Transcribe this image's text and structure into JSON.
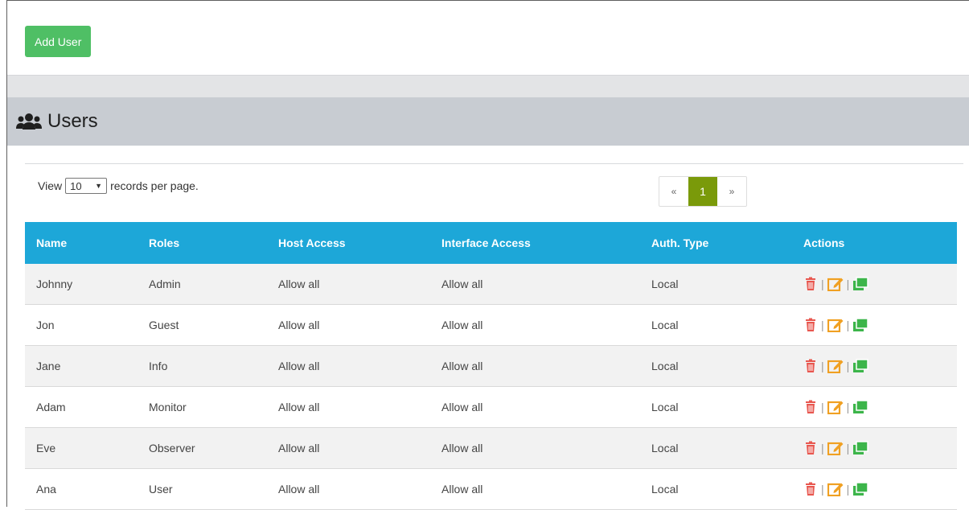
{
  "toolbar": {
    "add_user_label": "Add User"
  },
  "section": {
    "title": "Users"
  },
  "paging": {
    "view_prefix": "View",
    "records_value": "10",
    "view_suffix": "records per page.",
    "prev": "«",
    "current": "1",
    "next": "»"
  },
  "table": {
    "headers": [
      "Name",
      "Roles",
      "Host Access",
      "Interface Access",
      "Auth. Type",
      "Actions"
    ],
    "rows": [
      {
        "name": "Johnny",
        "role": "Admin",
        "host": "Allow all",
        "iface": "Allow all",
        "auth": "Local"
      },
      {
        "name": "Jon",
        "role": "Guest",
        "host": "Allow all",
        "iface": "Allow all",
        "auth": "Local"
      },
      {
        "name": "Jane",
        "role": "Info",
        "host": "Allow all",
        "iface": "Allow all",
        "auth": "Local"
      },
      {
        "name": "Adam",
        "role": "Monitor",
        "host": "Allow all",
        "iface": "Allow all",
        "auth": "Local"
      },
      {
        "name": "Eve",
        "role": "Observer",
        "host": "Allow all",
        "iface": "Allow all",
        "auth": "Local"
      },
      {
        "name": "Ana",
        "role": "User",
        "host": "Allow all",
        "iface": "Allow all",
        "auth": "Local"
      }
    ]
  },
  "icons": {
    "users": "users-icon",
    "delete": "trash-icon",
    "edit": "edit-icon",
    "copy": "copy-icon",
    "delete_color": "#e8574f",
    "edit_color": "#f0a022",
    "copy_color": "#3cb54a"
  },
  "colors": {
    "accent_green": "#4fbf65",
    "table_header": "#1da7d8",
    "pager_active": "#7a9a0a"
  }
}
